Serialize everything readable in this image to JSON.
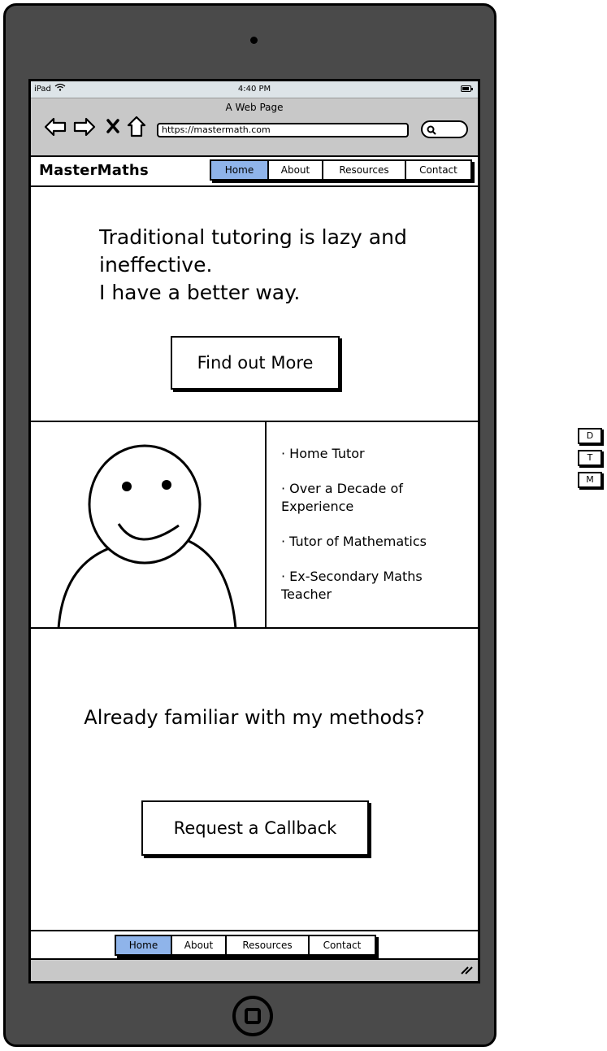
{
  "status_bar": {
    "device": "iPad",
    "time": "4:40 PM"
  },
  "browser": {
    "page_title": "A Web Page",
    "url": "https://mastermath.com"
  },
  "site": {
    "logo": "MasterMaths",
    "nav": [
      "Home",
      "About",
      "Resources",
      "Contact"
    ],
    "active_nav": "Home",
    "accent_color": "#8fb4ea"
  },
  "hero": {
    "lines": [
      "Traditional tutoring is lazy and",
      "ineffective.",
      "I have a better way."
    ],
    "button_label": "Find out More"
  },
  "about": {
    "bullets": [
      "· Home Tutor",
      "· Over a Decade of Experience",
      "· Tutor of Mathematics",
      "· Ex-Secondary Maths Teacher"
    ]
  },
  "callout": {
    "text": "Already familiar with my methods?",
    "button_label": "Request a Callback"
  },
  "footer": {
    "nav": [
      "Home",
      "About",
      "Resources",
      "Contact"
    ],
    "active_nav": "Home"
  },
  "side_widget": {
    "labels": [
      "D",
      "T",
      "M"
    ]
  }
}
